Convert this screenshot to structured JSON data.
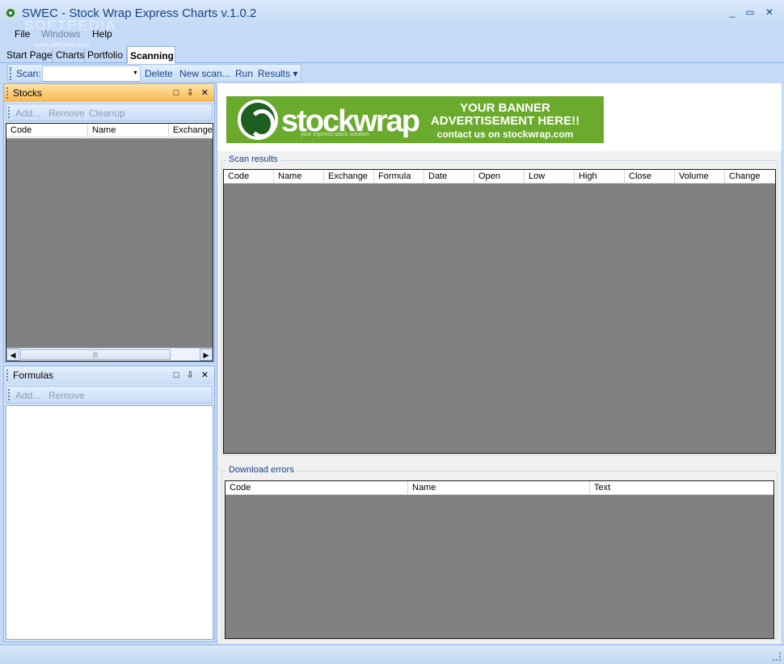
{
  "window": {
    "title": "SWEC - Stock Wrap Express Charts v.1.0.2",
    "watermark": "SOFTPEDIA",
    "watermark_sub": "www.softpedia.com",
    "minimize_glyph": "_",
    "maximize_glyph": "▭",
    "close_glyph": "✕"
  },
  "menu": [
    "File",
    "Windows",
    "Help"
  ],
  "tabs": [
    {
      "label": "Start Page",
      "active": false
    },
    {
      "label": "Charts",
      "active": false
    },
    {
      "label": "Portfolio",
      "active": false
    },
    {
      "label": "Scanning",
      "active": true
    }
  ],
  "toolbar": {
    "scan_label": "Scan:",
    "scan_value": "",
    "delete_label": "Delete",
    "new_scan_label": "New scan...",
    "run_label": "Run",
    "results_label": "Results ▾"
  },
  "stocks_panel": {
    "title": "Stocks",
    "header_icons": "□ ⇩ ✕",
    "buttons": [
      "Add...",
      "Remove",
      "Cleanup"
    ],
    "columns": [
      "Code",
      "Name",
      "Exchange"
    ],
    "scroll_left": "◀",
    "scroll_right": "▶",
    "scroll_thumb_grip": "|||"
  },
  "formulas_panel": {
    "title": "Formulas",
    "header_icons": "□ ⇩ ✕",
    "buttons": [
      "Add...",
      "Remove"
    ]
  },
  "banner": {
    "brand": "stockwrap",
    "tagline": "your express stock solution",
    "line1": "YOUR BANNER",
    "line2": "ADVERTISEMENT HERE!!",
    "line3": "contact us on stockwrap.com",
    "bg_color": "#6aaa2c"
  },
  "scan_results": {
    "label": "Scan results",
    "columns": [
      "Code",
      "Name",
      "Exchange",
      "Formula",
      "Date",
      "Open",
      "Low",
      "High",
      "Close",
      "Volume",
      "Change"
    ]
  },
  "download_errors": {
    "label": "Download errors",
    "columns": [
      "Code",
      "Name",
      "Text"
    ]
  },
  "colors": {
    "accent": "#15428b",
    "frame": "#c4daf7",
    "active_panel": "#f9b64f",
    "grid_bg": "#808080"
  }
}
